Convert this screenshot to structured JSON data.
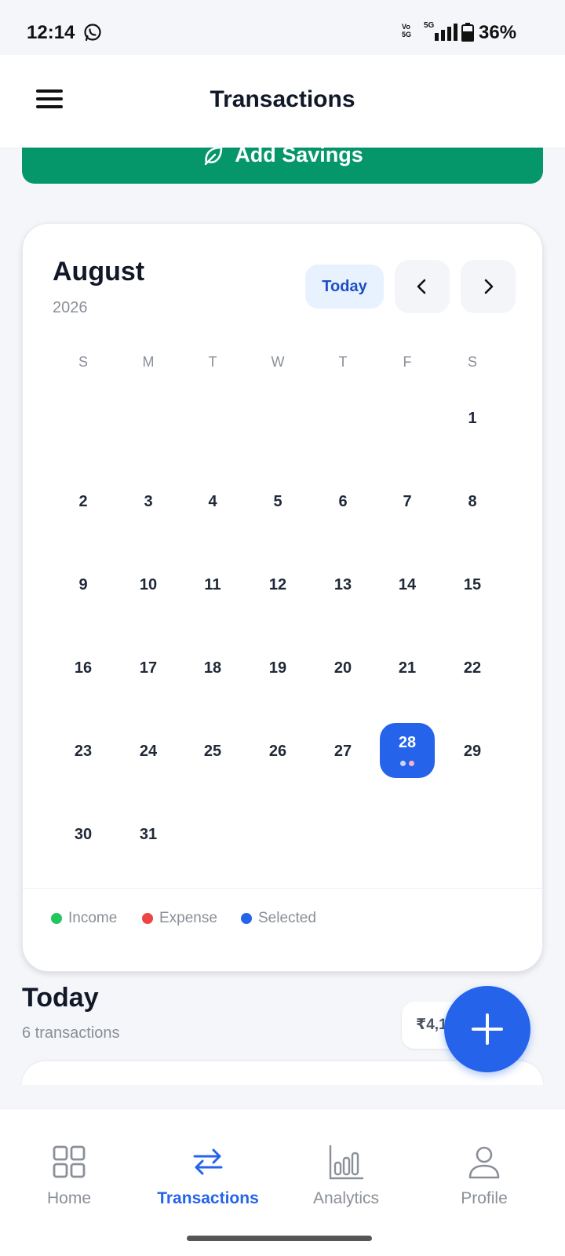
{
  "status_bar": {
    "time": "12:14",
    "volte": "Vo\n5G",
    "network": "5G",
    "battery": "36%"
  },
  "header": {
    "title": "Transactions",
    "menu_icon": "hamburger-menu-icon"
  },
  "add_savings": {
    "label": "Add Savings",
    "icon": "leaf-icon"
  },
  "calendar": {
    "month": "August",
    "year": "2026",
    "today_label": "Today",
    "weekdays": [
      "S",
      "M",
      "T",
      "W",
      "T",
      "F",
      "S"
    ],
    "days": [
      "1",
      "2",
      "3",
      "4",
      "5",
      "6",
      "7",
      "8",
      "9",
      "10",
      "11",
      "12",
      "13",
      "14",
      "15",
      "16",
      "17",
      "18",
      "19",
      "20",
      "21",
      "22",
      "23",
      "24",
      "25",
      "26",
      "27",
      "28",
      "29",
      "30",
      "31"
    ],
    "selected_day": "28",
    "legend": {
      "income": "Income",
      "expense": "Expense",
      "selected": "Selected"
    },
    "colors": {
      "income": "#22c55e",
      "expense": "#ef4444",
      "selected": "#2563eb"
    }
  },
  "today_section": {
    "title": "Today",
    "count": "6 transactions",
    "total_visible": "₹4,1"
  },
  "bottom_nav": {
    "items": [
      {
        "label": "Home",
        "icon": "grid-icon"
      },
      {
        "label": "Transactions",
        "icon": "swap-arrows-icon"
      },
      {
        "label": "Analytics",
        "icon": "bar-chart-icon"
      },
      {
        "label": "Profile",
        "icon": "person-icon"
      }
    ],
    "active": "Transactions"
  },
  "colors": {
    "accent": "#2563eb",
    "savings_green": "#05966a",
    "background": "#f4f6f9"
  }
}
